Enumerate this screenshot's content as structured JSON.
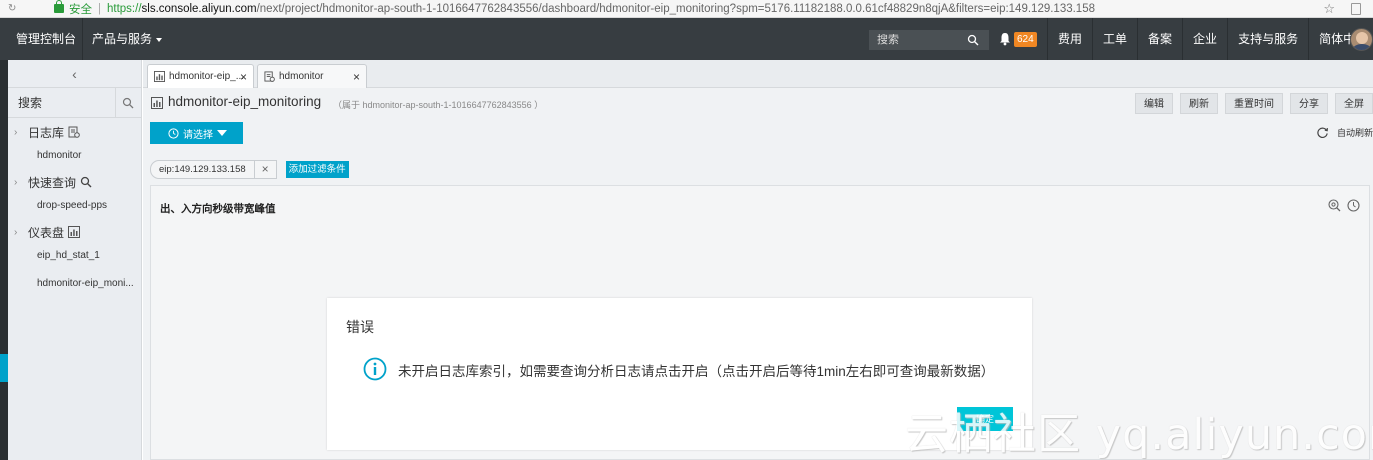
{
  "browser": {
    "security_label": "安全",
    "url_protocol": "https://",
    "url_host": "sls.console.aliyun.com",
    "url_path": "/next/project/hdmonitor-ap-south-1-1016647762843556/dashboard/hdmonitor-eip_monitoring?spm=5176.11182188.0.0.61cf48829n8qjA&filters=eip:149.129.133.158"
  },
  "topnav": {
    "console": "管理控制台",
    "products": "产品与服务",
    "search_placeholder": "搜索",
    "notification_count": "624",
    "links": [
      "费用",
      "工单",
      "备案",
      "企业",
      "支持与服务",
      "简体中文"
    ]
  },
  "sidebar": {
    "search_placeholder": "搜索",
    "groups": [
      {
        "label": "日志库",
        "icon": "logstore-icon",
        "items": [
          "hdmonitor"
        ]
      },
      {
        "label": "快速查询",
        "icon": "search-icon",
        "items": [
          "drop-speed-pps"
        ]
      },
      {
        "label": "仪表盘",
        "icon": "dashboard-icon",
        "items": [
          "eip_hd_stat_1",
          "hdmonitor-eip_moni..."
        ]
      }
    ]
  },
  "tabs": [
    {
      "label": "hdmonitor-eip_..."
    },
    {
      "label": "hdmonitor"
    }
  ],
  "dashboard": {
    "title": "hdmonitor-eip_monitoring",
    "subtitle": "（属于 hdmonitor-ap-south-1-1016647762843556 ）",
    "buttons": [
      "编辑",
      "刷新",
      "重置时间",
      "分享",
      "全屏"
    ],
    "select_label": "请选择",
    "auto_refresh": "自动刷新",
    "filter_chip": "eip:149.129.133.158",
    "add_filter": "添加过滤条件",
    "panel_title": "出、入方向秒级带宽峰值"
  },
  "modal": {
    "title": "错误",
    "message": "未开启日志库索引，如需要查询分析日志请点击开启（点击开启后等待1min左右即可查询最新数据）",
    "ok_label": "确定"
  },
  "watermark": "云栖社区 yq.aliyun.com",
  "colors": {
    "accent": "#00a2ca",
    "topnav_bg": "#373d41",
    "badge": "#f08723",
    "info_icon": "#00a2ca"
  }
}
